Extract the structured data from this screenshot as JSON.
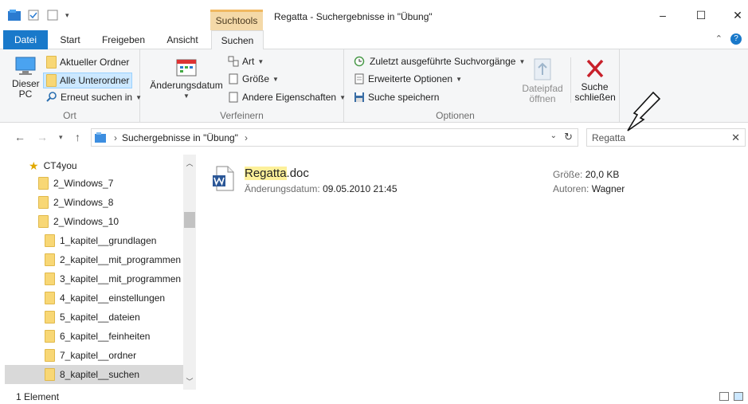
{
  "window": {
    "context_tab": "Suchtools",
    "title": "Regatta - Suchergebnisse in \"Übung\"",
    "minimize": "–",
    "maximize": "☐",
    "close": "✕"
  },
  "ribbon_tabs": [
    "Datei",
    "Start",
    "Freigeben",
    "Ansicht",
    "Suchen"
  ],
  "ribbon": {
    "ort": {
      "label": "Ort",
      "dieser_pc": "Dieser PC",
      "aktueller_ordner": "Aktueller Ordner",
      "alle_unterordner": "Alle Unterordner",
      "erneut_suchen": "Erneut suchen in"
    },
    "verfeinern": {
      "label": "Verfeinern",
      "aenderungsdatum": "Änderungsdatum",
      "art": "Art",
      "groesse": "Größe",
      "andere": "Andere Eigenschaften"
    },
    "optionen": {
      "label": "Optionen",
      "zuletzt": "Zuletzt ausgeführte Suchvorgänge",
      "erweitert": "Erweiterte Optionen",
      "speichern": "Suche speichern",
      "dateipfad": "Dateipfad öffnen",
      "schliessen": "Suche schließen"
    }
  },
  "address": {
    "path": "Suchergebnisse in \"Übung\"",
    "search_value": "Regatta"
  },
  "nav_tree": [
    {
      "label": "CT4you",
      "type": "star"
    },
    {
      "label": "2_Windows_7",
      "type": "folder"
    },
    {
      "label": "2_Windows_8",
      "type": "folder"
    },
    {
      "label": "2_Windows_10",
      "type": "folder"
    },
    {
      "label": "1_kapitel__grundlagen",
      "type": "folder"
    },
    {
      "label": "2_kapitel__mit_programmen",
      "type": "folder"
    },
    {
      "label": "3_kapitel__mit_programmen",
      "type": "folder"
    },
    {
      "label": "4_kapitel__einstellungen",
      "type": "folder"
    },
    {
      "label": "5_kapitel__dateien",
      "type": "folder"
    },
    {
      "label": "6_kapitel__feinheiten",
      "type": "folder"
    },
    {
      "label": "7_kapitel__ordner",
      "type": "folder"
    },
    {
      "label": "8_kapitel__suchen",
      "type": "folder"
    }
  ],
  "result": {
    "name_highlight": "Regatta",
    "name_rest": ".doc",
    "date_key": "Änderungsdatum:",
    "date_value": "09.05.2010 21:45",
    "size_key": "Größe:",
    "size_value": "20,0 KB",
    "author_key": "Autoren:",
    "author_value": "Wagner"
  },
  "status": {
    "count": "1 Element"
  },
  "colors": {
    "accent": "#1979ca",
    "context_tab": "#f4d9a8",
    "highlight": "#fdf09a"
  }
}
